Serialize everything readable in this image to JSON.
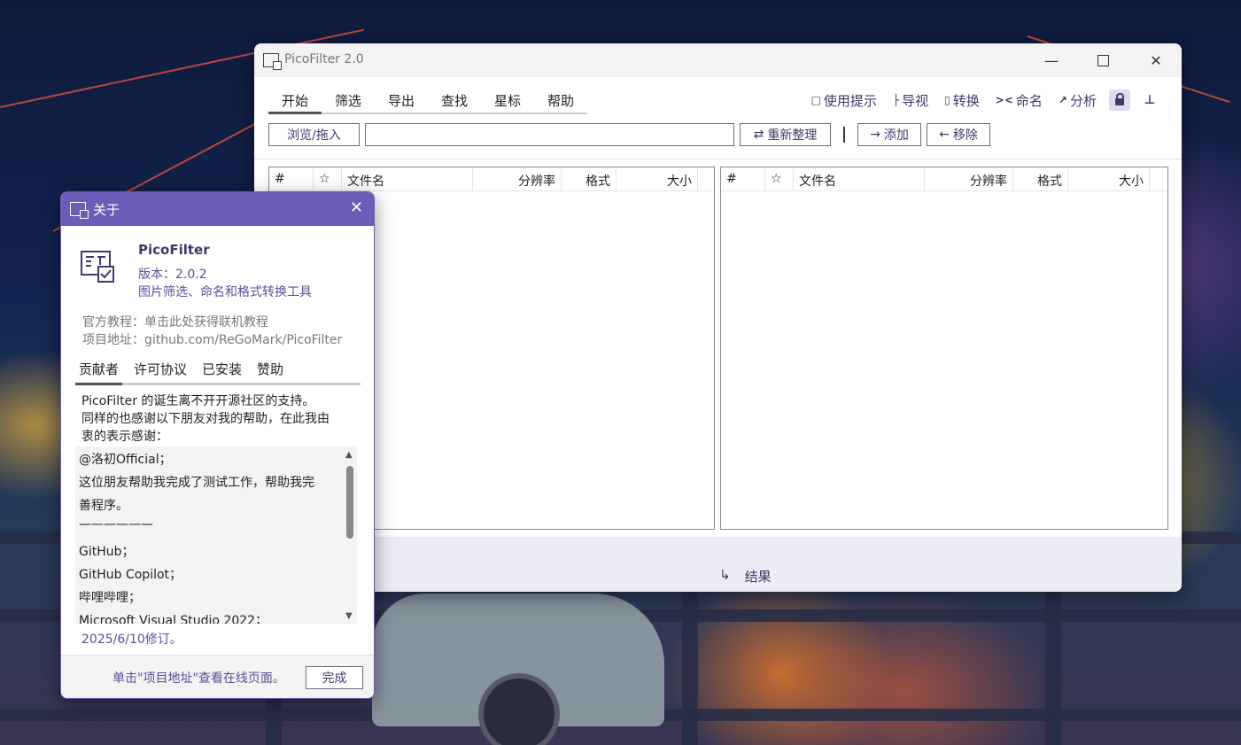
{
  "main_window": {
    "title": "PicoFilter 2.0",
    "menu": [
      "开始",
      "筛选",
      "导出",
      "查找",
      "星标",
      "帮助"
    ],
    "tools": {
      "tips": "使用提示",
      "view": "导视",
      "convert": "转换",
      "rename": "命名",
      "analyze": "分析"
    },
    "browse_label": "浏览/拖入",
    "path_value": "",
    "reorganize_label": "重新整理",
    "add_label": "添加",
    "remove_label": "移除",
    "columns": [
      "#",
      "☆",
      "文件名",
      "分辨率",
      "格式",
      "大小"
    ],
    "result_label": "结果"
  },
  "about": {
    "title": "关于",
    "app_name": "PicoFilter",
    "version": "版本：2.0.2",
    "description": "图片筛选、命名和格式转换工具",
    "tutorial": "官方教程：单击此处获得联机教程",
    "project": "项目地址：github.com/ReGoMark/PicoFilter",
    "tabs": [
      "贡献者",
      "许可协议",
      "已安装",
      "赞助"
    ],
    "intro_lines": [
      "PicoFilter 的诞生离不开开源社区的支持。",
      "同样的也感谢以下朋友对我的帮助，在此我由",
      "衷的表示感谢："
    ],
    "credits": [
      "@洛初Official；",
      "这位朋友帮助我完成了测试工作，帮助我完",
      "善程序。",
      "——————",
      "GitHub；",
      "GitHub Copilot；",
      "哔哩哔哩；",
      "Microsoft Visual Studio 2022；"
    ],
    "revised": "2025/6/10修订。",
    "footer_hint": "单击\"项目地址\"查看在线页面。",
    "done_label": "完成"
  },
  "colors": {
    "accent": "#6c5cb7",
    "text_purple": "#3e3a6a"
  }
}
